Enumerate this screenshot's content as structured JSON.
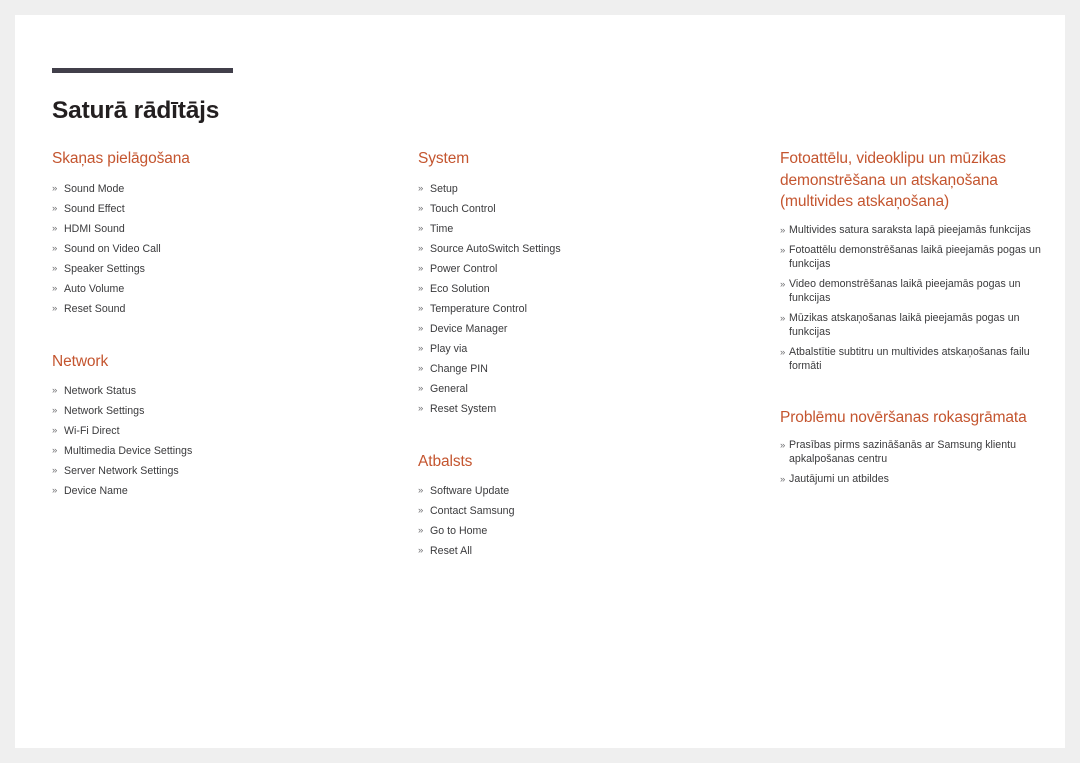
{
  "document": {
    "title": "Saturā rādītājs",
    "accent_color": "#c4552f",
    "rule_color": "#413f4a",
    "title_color": "#231f20",
    "body_text_color": "#3a3a3c",
    "page_background": "#ffffff",
    "canvas_background": "#efefef",
    "bullet_marker": "»"
  },
  "columns": {
    "left": [
      {
        "heading": "Skaņas pielāgošana",
        "items": [
          "Sound Mode",
          "Sound Effect",
          "HDMI Sound",
          "Sound on Video Call",
          "Speaker Settings",
          "Auto Volume",
          "Reset Sound"
        ]
      },
      {
        "heading": "Network",
        "items": [
          "Network Status",
          "Network Settings",
          "Wi-Fi Direct",
          "Multimedia Device Settings",
          "Server Network Settings",
          "Device Name"
        ]
      }
    ],
    "middle": [
      {
        "heading": "System",
        "items": [
          "Setup",
          "Touch Control",
          "Time",
          "Source AutoSwitch Settings",
          "Power Control",
          "Eco Solution",
          "Temperature Control",
          "Device Manager",
          "Play via",
          "Change PIN",
          "General",
          "Reset System"
        ]
      },
      {
        "heading": "Atbalsts",
        "items": [
          "Software Update",
          "Contact Samsung",
          "Go to Home",
          "Reset All"
        ]
      }
    ],
    "right": [
      {
        "heading": "Fotoattēlu, videoklipu un mūzikas demonstrēšana un atskaņošana (multivides atskaņošana)",
        "items": [
          "Multivides satura saraksta lapā pieejamās funkcijas",
          "Fotoattēlu demonstrēšanas laikā pieejamās pogas un funkcijas",
          "Video demonstrēšanas laikā pieejamās pogas un funkcijas",
          "Mūzikas atskaņošanas laikā pieejamās pogas un funkcijas",
          "Atbalstītie subtitru un multivides atskaņošanas failu formāti"
        ]
      },
      {
        "heading": "Problēmu novēršanas rokasgrāmata",
        "items": [
          "Prasības pirms sazināšanās ar Samsung klientu apkalpošanas centru",
          "Jautājumi un atbildes"
        ]
      }
    ]
  }
}
